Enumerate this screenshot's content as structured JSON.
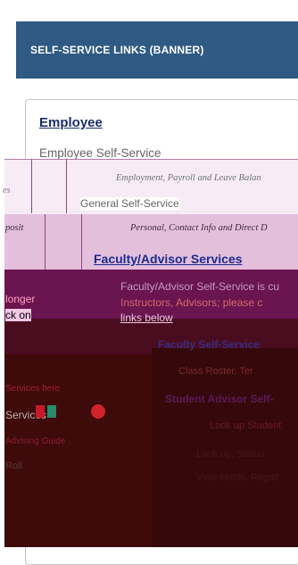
{
  "header": {
    "title": "SELF-SERVICE LINKS (BANNER)"
  },
  "employee": {
    "heading": "Employee",
    "self_service": "Employee Self-Service",
    "desc": "Employment, Payroll and Leave Balan"
  },
  "general": {
    "label": "General Self-Service",
    "desc": "Personal, Contact Info and Direct D"
  },
  "faculty": {
    "heading": "Faculty/Advisor Services",
    "desc_line1": "Faculty/Advisor Self-Service is cu",
    "desc_line2": "Instructors, Advisors; please c",
    "desc_line3": "links below",
    "sub_self_service": "Faculty Self-Service",
    "sub_desc": "Class Roster, Ter",
    "sub_advisor": "Student Advisor Self-",
    "sub_advisor_desc1": "Look up Student",
    "sub_advisor_desc2": "Look up, Status",
    "sub_advisor_desc3": "View Holds, Regist"
  },
  "left_fragments": {
    "es": "es",
    "posit": "posit",
    "longer": "longer",
    "ck_on": "ck on",
    "pink1": "Services here",
    "services": "Services",
    "pink2": "Advising Guide",
    "gray": "Roll"
  },
  "colors": {
    "header_bg": "#2f5a83",
    "link": "#1a2d6b",
    "glitch_pink": "#e3bfdc",
    "glitch_dark": "#3e0a0a"
  }
}
